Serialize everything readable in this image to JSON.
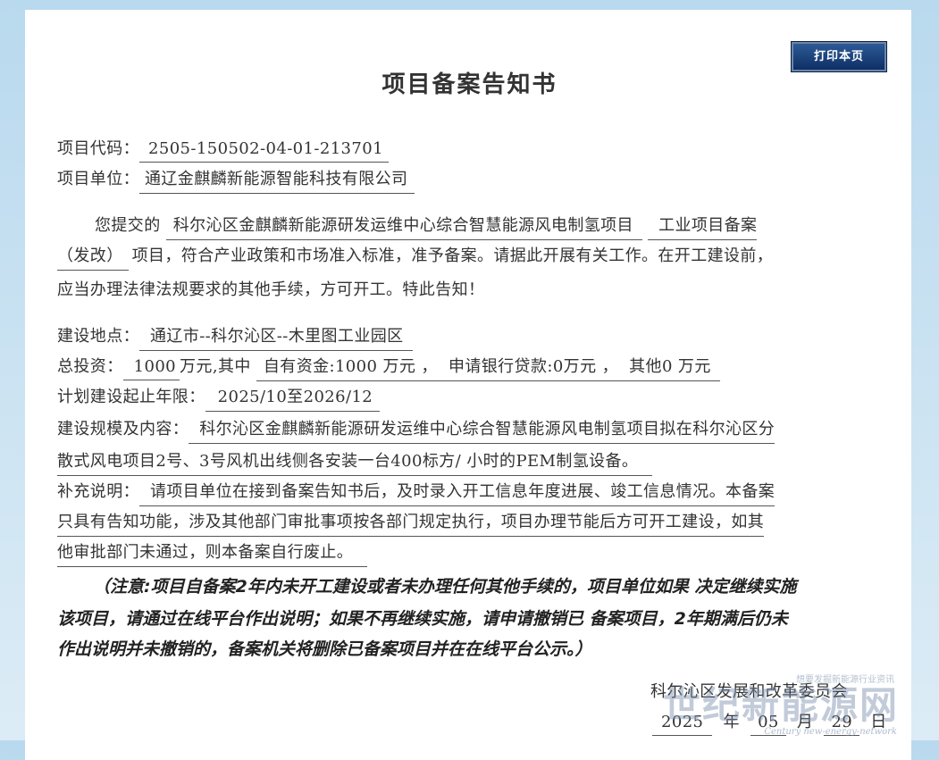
{
  "print_button": "打印本页",
  "title": "项目备案告知书",
  "code_label": "项目代码：",
  "code_value": "2505-150502-04-01-213701",
  "unit_label": "项目单位：",
  "unit_value": "通辽金麒麟新能源智能科技有限公司",
  "body": {
    "p1_prefix": "您提交的",
    "project_name": "科尔沁区金麒麟新能源研发运维中心综合智慧能源风电制氢项目",
    "record_type_a": "工业项目备案",
    "record_type_b": "（发改）",
    "p1_rest": "项目，符合产业政策和市场准入标准，准予备案。请据此开展有关工作。在开工建设前，",
    "p1_line3": "应当办理法律法规要求的其他手续，方可开工。特此告知！"
  },
  "location_label": "建设地点：",
  "location_value": "通辽市--科尔沁区--木里图工业园区",
  "investment": {
    "label": "总投资：",
    "total": "1000",
    "unit_sep": "万元,其中",
    "own": "自有资金:1000 万元",
    "sep1": "，",
    "loan": "申请银行贷款:0万元",
    "sep2": "，",
    "other": "其他0 万元"
  },
  "period_label": "计划建设起止年限：",
  "period_value": "2025/10至2026/12",
  "scale_label": "建设规模及内容：",
  "scale_line1": "科尔沁区金麒麟新能源研发运维中心综合智慧能源风电制氢项目拟在科尔沁区分",
  "scale_line2": "散式风电项目2号、3号风机出线侧各安装一台400标方/ 小时的PEM制氢设备。",
  "supp_label": "补充说明：",
  "supp_line1": "请项目单位在接到备案告知书后，及时录入开工信息年度进展、竣工信息情况。本备案",
  "supp_line2": "只具有告知功能，涉及其他部门审批事项按各部门规定执行，项目办理节能后方可开工建设，如其",
  "supp_line3": "他审批部门未通过，则本备案自行废止。",
  "note": {
    "open": "（",
    "bold": "注意:",
    "line1": "项目自备案2年内未开工建设或者未办理任何其他手续的，项目单位如果 决定继续实施",
    "line2": "该项目，请通过在线平台作出说明；如果不再继续实施，请申请撤销已 备案项目，2年期满后仍未",
    "line3": "作出说明并未撤销的，备案机关将删除已备案项目并在在线平台公示。）"
  },
  "issuer": "科尔沁区发展和改革委员会",
  "date": {
    "year": "2025",
    "year_unit": "年",
    "month": "05",
    "month_unit": "月",
    "day": "29",
    "day_unit": "日"
  },
  "watermark": {
    "main": "世纪新能源网",
    "sub": "Century new-energy-network",
    "top": "想要发掘新能源行业资讯"
  }
}
